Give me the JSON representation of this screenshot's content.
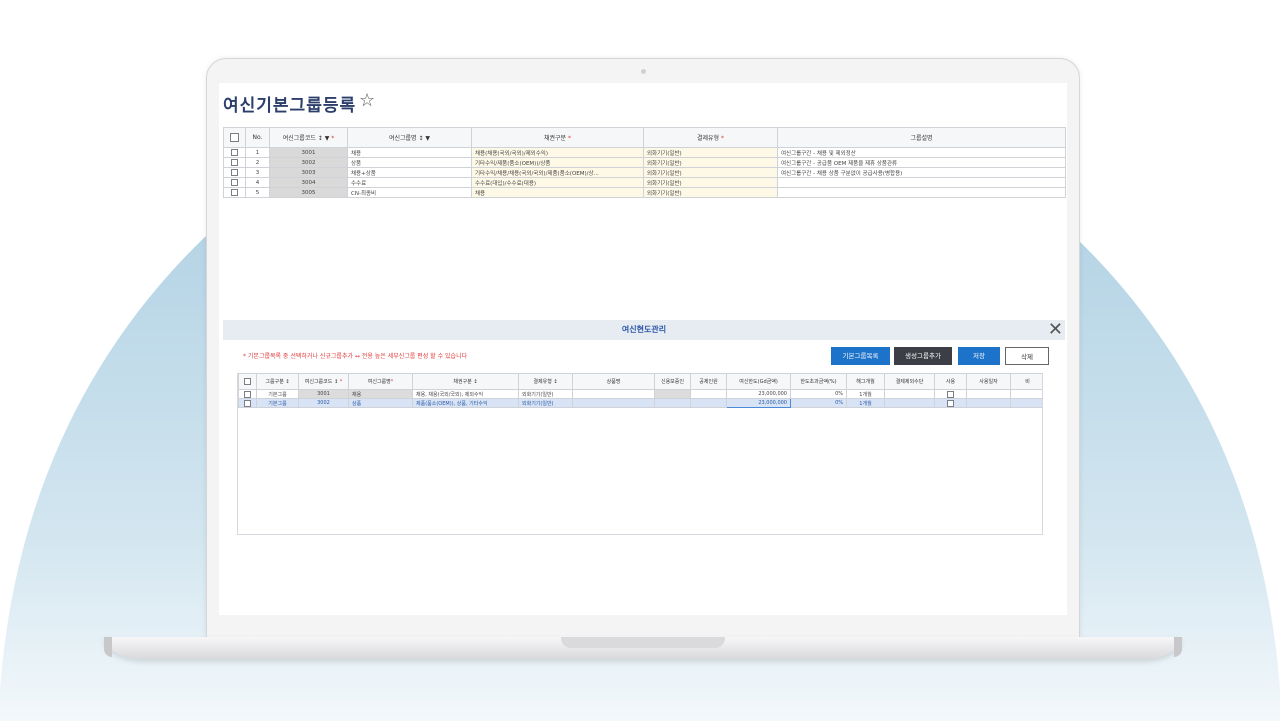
{
  "page": {
    "title": "여신기본그룹등록",
    "star_icon": "star-outline-icon"
  },
  "group_grid": {
    "headers": [
      "No.",
      "여신그룹코드 ↕ ▼",
      "여신그룹명 ↕ ▼",
      "채권구분",
      "결제유형",
      "그룹설명"
    ],
    "rows": [
      {
        "no": "1",
        "code": "3001",
        "name": "채용",
        "bond": "채용(채용(국외/국외)/제외수익)",
        "pay": "외화기기(일반)",
        "desc": "여신그룹구간 - 채용 및 제외정산"
      },
      {
        "no": "2",
        "code": "3002",
        "name": "상품",
        "bond": "기타수익/제품(품소(OEM))/상품",
        "pay": "외화기기(일반)",
        "desc": "여신그룹구간 - 공급품 OEM 제품을 제휴 상품관류"
      },
      {
        "no": "3",
        "code": "3003",
        "name": "채용+상품",
        "bond": "기타수익/채용/채용(국외/국외)/제품(품소(OEM)/상...",
        "pay": "외화기기(일반)",
        "desc": "여신그룹구간 - 채용 상품 구분없이 공급사용(병합용)"
      },
      {
        "no": "4",
        "code": "3004",
        "name": "수수료",
        "bond": "수수료(대입)/수수료(대용)",
        "pay": "외화기기(일반)",
        "desc": ""
      },
      {
        "no": "5",
        "code": "3005",
        "name": "CN-최종비",
        "bond": "채용",
        "pay": "외화기기(일반)",
        "desc": ""
      }
    ]
  },
  "detail": {
    "title": "여신현도관리",
    "close_icon": "close-icon",
    "notice": "* 기본그룹목록 중 선택하거나 신규그룹추가 ↔ 전용 높은 세부신그룹 편성 할 수 있습니다",
    "buttons": {
      "add_basic": "기본그룹목록",
      "add_new": "생성그룹추가",
      "save": "저장",
      "delete": "삭제"
    },
    "headers": [
      "그룹구분 ↕",
      "여신그룹코드 ↕",
      "여신그룹명",
      "채권구분 ↕",
      "결제유형 ↕",
      "상품명",
      "신용보증인",
      "공제인원",
      "여신한도(Gd금액)",
      "한도초과금액(%)",
      "해그개월",
      "결제제외수단",
      "사용",
      "사용일자",
      "비"
    ],
    "rows": [
      {
        "type": "기본그룹",
        "code": "3001",
        "name": "채용",
        "bond": "채용, 채용(국외/국외), 제외수익",
        "pay": "외화기기(일반)",
        "product": "",
        "guar": "",
        "deduct": "",
        "limit": "23,000,000",
        "over": "0%",
        "month": "1개월",
        "excl": "",
        "date": ""
      },
      {
        "type": "기본그룹",
        "code": "3002",
        "name": "상품",
        "bond": "제품(품소(OEM)), 상품, 기타수익",
        "pay": "외화기기(일반)",
        "product": "",
        "guar": "",
        "deduct": "",
        "limit": "23,000,000",
        "over": "0%",
        "month": "1개월",
        "excl": "",
        "date": ""
      }
    ]
  },
  "colors": {
    "title": "#2c3f6b",
    "accent_blue": "#1d72c9",
    "dark_button": "#3b3f45",
    "required_red": "#e23b3b",
    "code_gray": "#d9d9d9",
    "yellow_cell": "#fdf9e6"
  }
}
